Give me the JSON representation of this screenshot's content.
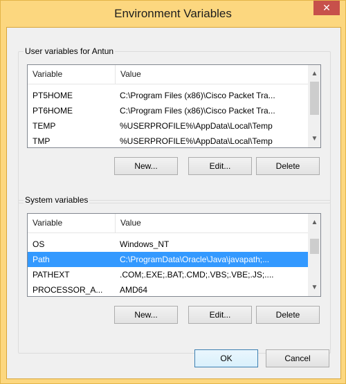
{
  "window": {
    "title": "Environment Variables",
    "close_glyph": "✕"
  },
  "user_section": {
    "label": "User variables for Antun",
    "columns": [
      "Variable",
      "Value"
    ],
    "rows": [
      {
        "variable": "PT5HOME",
        "value": "C:\\Program Files (x86)\\Cisco Packet Tra..."
      },
      {
        "variable": "PT6HOME",
        "value": "C:\\Program Files (x86)\\Cisco Packet Tra..."
      },
      {
        "variable": "TEMP",
        "value": "%USERPROFILE%\\AppData\\Local\\Temp"
      },
      {
        "variable": "TMP",
        "value": "%USERPROFILE%\\AppData\\Local\\Temp"
      }
    ],
    "buttons": {
      "new": "New...",
      "edit": "Edit...",
      "delete": "Delete"
    }
  },
  "system_section": {
    "label": "System variables",
    "columns": [
      "Variable",
      "Value"
    ],
    "rows": [
      {
        "variable": "OS",
        "value": "Windows_NT"
      },
      {
        "variable": "Path",
        "value": "C:\\ProgramData\\Oracle\\Java\\javapath;..."
      },
      {
        "variable": "PATHEXT",
        "value": ".COM;.EXE;.BAT;.CMD;.VBS;.VBE;.JS;...."
      },
      {
        "variable": "PROCESSOR_A...",
        "value": "AMD64"
      }
    ],
    "selected_row": "Path",
    "buttons": {
      "new": "New...",
      "edit": "Edit...",
      "delete": "Delete"
    }
  },
  "footer": {
    "ok": "OK",
    "cancel": "Cancel"
  },
  "scroll_icons": {
    "up": "▲",
    "down": "▼"
  }
}
